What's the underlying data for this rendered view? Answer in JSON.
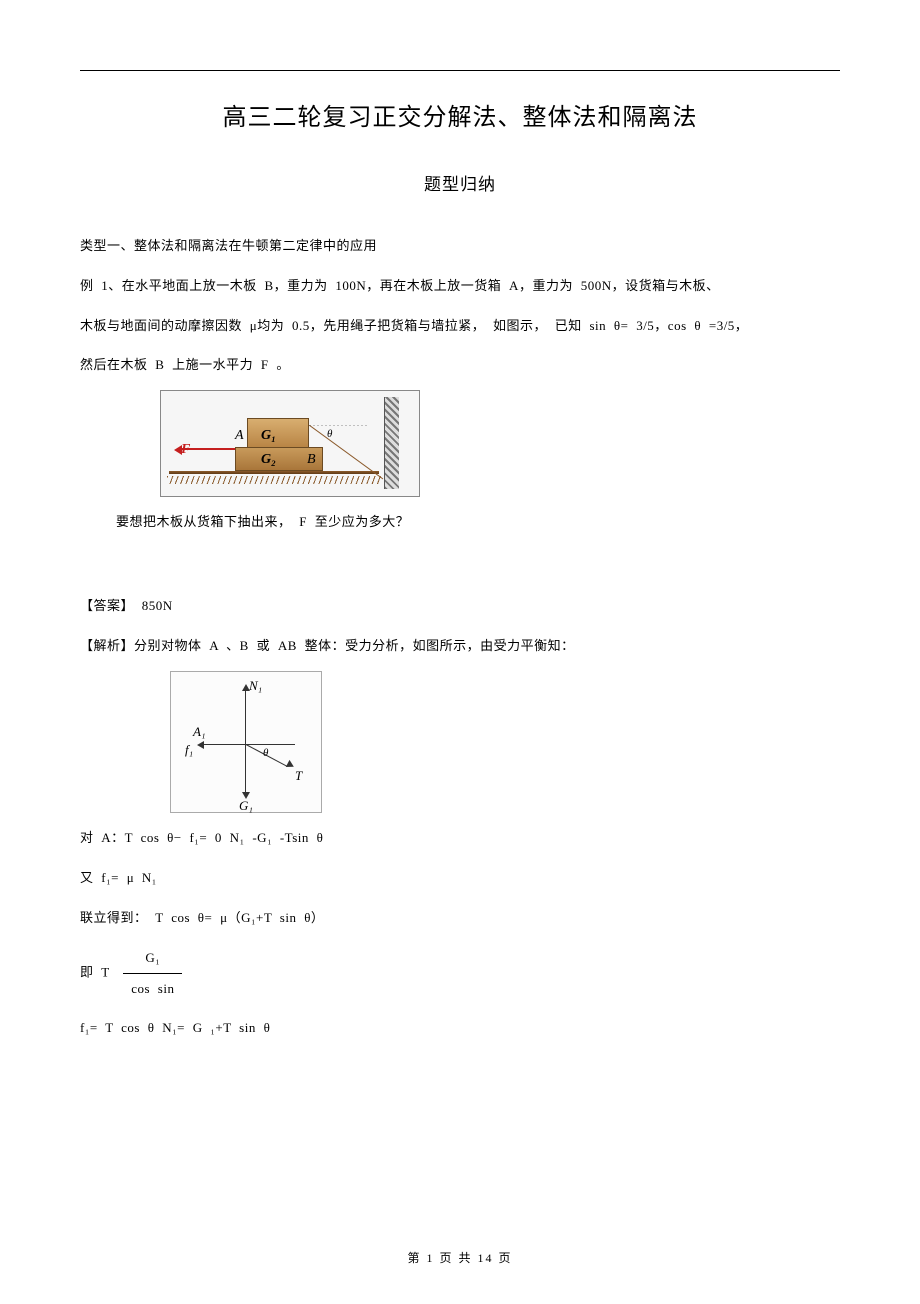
{
  "title": "高三二轮复习正交分解法、整体法和隔离法",
  "subtitle": "题型归纳",
  "category_heading": "类型一、整体法和隔离法在牛顿第二定律中的应用",
  "example1_line1": "例 1、在水平地面上放一木板    B，重力为  100N，再在木板上放一货箱   A，重力为  500N，设货箱与木板、",
  "example1_line2": "木板与地面间的动摩擦因数     μ均为 0.5，先用绳子把货箱与墙拉紧，   如图示， 已知  sin θ= 3/5，cos  θ =3/5，",
  "example1_line3": "然后在木板  B 上施一水平力   F 。",
  "fig1": {
    "F": "F",
    "A": "A",
    "B": "B",
    "G1": "G₁",
    "G2": "G₂",
    "theta": "θ"
  },
  "question": "要想把木板从货箱下抽出来，     F 至少应为多大？",
  "answer_label": "【答案】  850N",
  "explain_line1": "【解析】分别对物体    A 、B 或 AB 整体：受力分析，如图所示，由受力平衡知：",
  "fig2": {
    "N1": "N₁",
    "A": "A₁",
    "f1": "f₁",
    "G1": "G₁",
    "T": "T",
    "theta": "θ"
  },
  "eqA": "对 A：T cos  θ− f₁= 0      N₁ -G₁ -Tsin θ",
  "eqf": "又 f₁= μ N₁",
  "eq_combine": "联立得到：  T cos  θ= μ（G₁+T sin  θ）",
  "eqT_prefix": "即 T",
  "frac_num": "G₁",
  "frac_den": "cos        sin",
  "eq_last": "f₁= T cos  θ       N₁= G ₁+T sin  θ",
  "footer": "第  1 页 共  14 页"
}
